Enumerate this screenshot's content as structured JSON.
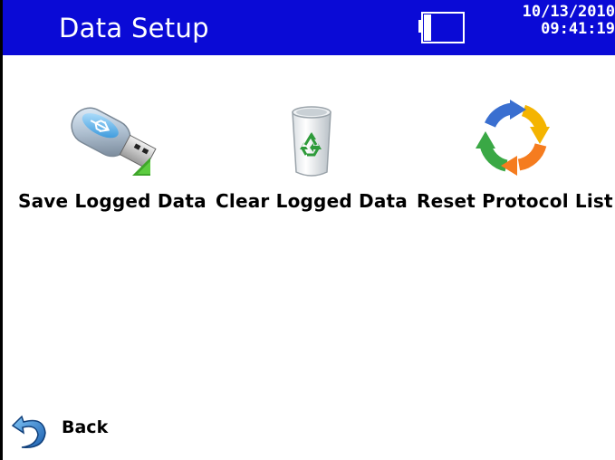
{
  "header": {
    "title": "Data Setup",
    "date": "10/13/2010",
    "time": "09:41:19",
    "battery_icon": "battery-empty-icon",
    "background_color": "#0a0ad6"
  },
  "actions": [
    {
      "label": "Save Logged Data",
      "icon": "usb-drive-icon"
    },
    {
      "label": "Clear Logged Data",
      "icon": "recycle-bin-icon"
    },
    {
      "label": "Reset Protocol List",
      "icon": "refresh-cycle-icon"
    }
  ],
  "footer": {
    "back_label": "Back",
    "back_icon": "back-arrow-icon"
  }
}
